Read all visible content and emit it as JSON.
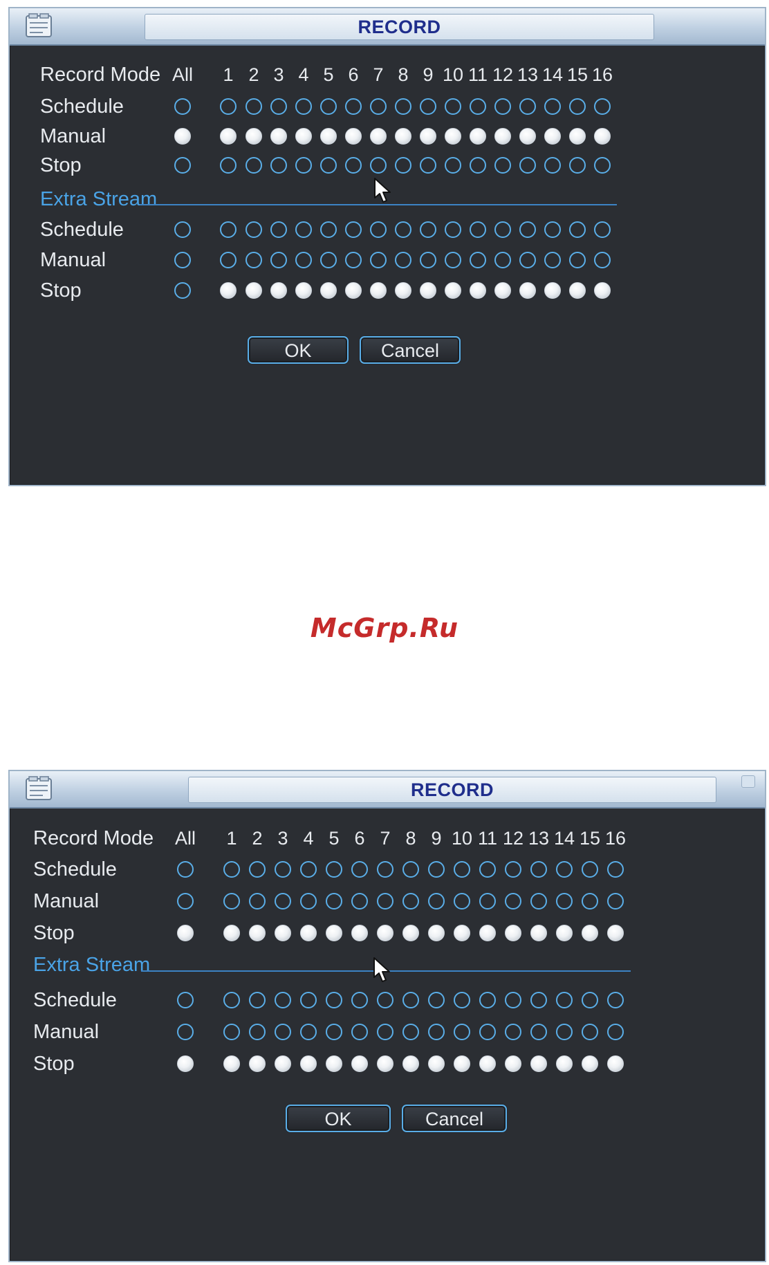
{
  "dialogs": [
    {
      "title": "RECORD",
      "header": {
        "mode_label": "Record Mode",
        "all_label": "All",
        "channels": [
          "1",
          "2",
          "3",
          "4",
          "5",
          "6",
          "7",
          "8",
          "9",
          "10",
          "11",
          "12",
          "13",
          "14",
          "15",
          "16"
        ]
      },
      "main_stream": [
        {
          "label": "Schedule",
          "all": false,
          "channels": [
            false,
            false,
            false,
            false,
            false,
            false,
            false,
            false,
            false,
            false,
            false,
            false,
            false,
            false,
            false,
            false
          ]
        },
        {
          "label": "Manual",
          "all": true,
          "channels": [
            true,
            true,
            true,
            true,
            true,
            true,
            true,
            true,
            true,
            true,
            true,
            true,
            true,
            true,
            true,
            true
          ]
        },
        {
          "label": "Stop",
          "all": false,
          "channels": [
            false,
            false,
            false,
            false,
            false,
            false,
            false,
            false,
            false,
            false,
            false,
            false,
            false,
            false,
            false,
            false
          ]
        }
      ],
      "extra_stream_label": "Extra Stream",
      "extra_stream": [
        {
          "label": "Schedule",
          "all": false,
          "channels": [
            false,
            false,
            false,
            false,
            false,
            false,
            false,
            false,
            false,
            false,
            false,
            false,
            false,
            false,
            false,
            false
          ]
        },
        {
          "label": "Manual",
          "all": false,
          "channels": [
            false,
            false,
            false,
            false,
            false,
            false,
            false,
            false,
            false,
            false,
            false,
            false,
            false,
            false,
            false,
            false
          ]
        },
        {
          "label": "Stop",
          "all": false,
          "channels": [
            true,
            true,
            true,
            true,
            true,
            true,
            true,
            true,
            true,
            true,
            true,
            true,
            true,
            true,
            true,
            true
          ]
        }
      ],
      "ok_label": "OK",
      "cancel_label": "Cancel"
    },
    {
      "title": "RECORD",
      "header": {
        "mode_label": "Record Mode",
        "all_label": "All",
        "channels": [
          "1",
          "2",
          "3",
          "4",
          "5",
          "6",
          "7",
          "8",
          "9",
          "10",
          "11",
          "12",
          "13",
          "14",
          "15",
          "16"
        ]
      },
      "main_stream": [
        {
          "label": "Schedule",
          "all": false,
          "channels": [
            false,
            false,
            false,
            false,
            false,
            false,
            false,
            false,
            false,
            false,
            false,
            false,
            false,
            false,
            false,
            false
          ]
        },
        {
          "label": "Manual",
          "all": false,
          "channels": [
            false,
            false,
            false,
            false,
            false,
            false,
            false,
            false,
            false,
            false,
            false,
            false,
            false,
            false,
            false,
            false
          ]
        },
        {
          "label": "Stop",
          "all": true,
          "channels": [
            true,
            true,
            true,
            true,
            true,
            true,
            true,
            true,
            true,
            true,
            true,
            true,
            true,
            true,
            true,
            true
          ]
        }
      ],
      "extra_stream_label": "Extra Stream",
      "extra_stream": [
        {
          "label": "Schedule",
          "all": false,
          "channels": [
            false,
            false,
            false,
            false,
            false,
            false,
            false,
            false,
            false,
            false,
            false,
            false,
            false,
            false,
            false,
            false
          ]
        },
        {
          "label": "Manual",
          "all": false,
          "channels": [
            false,
            false,
            false,
            false,
            false,
            false,
            false,
            false,
            false,
            false,
            false,
            false,
            false,
            false,
            false,
            false
          ]
        },
        {
          "label": "Stop",
          "all": true,
          "channels": [
            true,
            true,
            true,
            true,
            true,
            true,
            true,
            true,
            true,
            true,
            true,
            true,
            true,
            true,
            true,
            true
          ]
        }
      ],
      "ok_label": "OK",
      "cancel_label": "Cancel"
    }
  ],
  "watermark": "McGrp.Ru",
  "colors": {
    "accent": "#5aaee8",
    "section": "#4aa3e6",
    "panel": "#2b2e33",
    "title_text": "#1f2e8c",
    "watermark": "#c52b2b"
  }
}
